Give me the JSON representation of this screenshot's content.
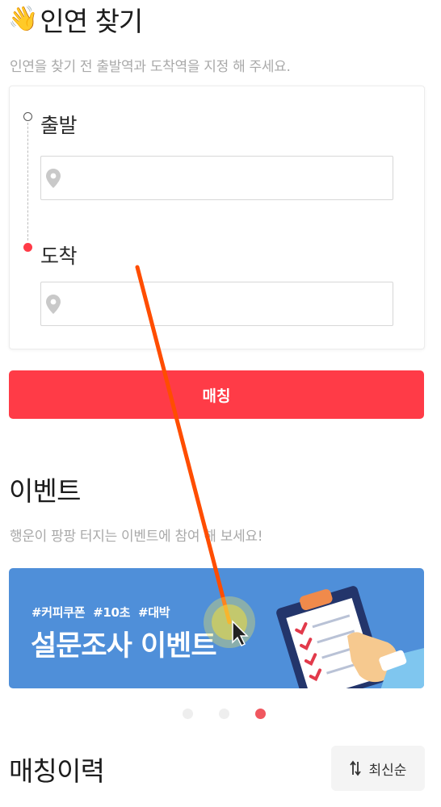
{
  "find_section": {
    "title": "인연 찾기",
    "title_emoji": "👋",
    "subtitle": "인연을 찾기 전 출발역과 도착역을 지정 해 주세요.",
    "departure_label": "출발",
    "departure_value": "",
    "arrival_label": "도착",
    "arrival_value": "",
    "match_button": "매칭"
  },
  "event_section": {
    "title": "이벤트",
    "subtitle": "행운이 팡팡 터지는 이벤트에 참여 해 보세요!",
    "banner_tags": "#커피쿠폰  #10초  #대박",
    "banner_title": "설문조사 이벤트",
    "page_count": 3,
    "active_page": 3
  },
  "history_section": {
    "title": "매칭이력",
    "sort_label": "최신순"
  },
  "colors": {
    "accent": "#ff3b47",
    "banner_bg": "#4f8fd9",
    "annotation_line": "#ff4d00"
  },
  "icons": [
    "waving-hand-icon",
    "location-pin-icon",
    "sort-arrows-icon",
    "mouse-cursor-icon"
  ]
}
